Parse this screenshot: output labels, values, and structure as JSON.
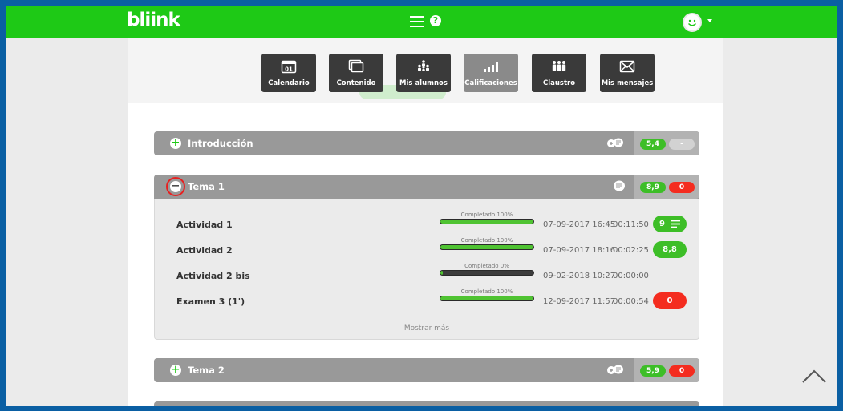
{
  "header": {
    "logo": "bliink",
    "menu_icon": "hamburger-menu-icon",
    "help_icon": "help-icon",
    "help_glyph": "?",
    "avatar_icon": "smiley-avatar-icon",
    "colors": {
      "green": "#1ec916",
      "frame_blue": "#0a5fa3"
    }
  },
  "nav": [
    {
      "label": "Calendario",
      "icon": "calendar-icon",
      "calendar_day": "01",
      "active": false
    },
    {
      "label": "Contenido",
      "icon": "content-icon",
      "active": false
    },
    {
      "label": "Mis alumnos",
      "icon": "students-icon",
      "active": false
    },
    {
      "label": "Calificaciones",
      "icon": "grades-chart-icon",
      "active": true
    },
    {
      "label": "Claustro",
      "icon": "faculty-icon",
      "active": false
    },
    {
      "label": "Mis mensajes",
      "icon": "mail-icon",
      "active": false
    }
  ],
  "sections": [
    {
      "title": "Introducción",
      "expanded": false,
      "score": "5,4",
      "extra": "-"
    },
    {
      "title": "Tema 1",
      "expanded": true,
      "score": "8,9",
      "extra": "0"
    },
    {
      "title": "Tema 2",
      "expanded": false,
      "score": "5,9",
      "extra": "0"
    }
  ],
  "activities": [
    {
      "name": "Actividad 1",
      "progress_label": "Completado 100%",
      "progress": 100,
      "date": "07-09-2017 16:45",
      "duration": "00:11:50",
      "result": "9",
      "result_color": "green",
      "has_comment_icon": true
    },
    {
      "name": "Actividad 2",
      "progress_label": "Completado 100%",
      "progress": 100,
      "date": "07-09-2017 18:16",
      "duration": "00:02:25",
      "result": "8,8",
      "result_color": "green",
      "has_comment_icon": false
    },
    {
      "name": "Actividad 2 bis",
      "progress_label": "Completado 0%",
      "progress": 0,
      "date": "09-02-2018 10:27",
      "duration": "00:00:00",
      "result": "",
      "result_color": "none",
      "has_comment_icon": false
    },
    {
      "name": "Examen 3 (1')",
      "progress_label": "Completado 100%",
      "progress": 100,
      "date": "12-09-2017 11:57",
      "duration": "00:00:54",
      "result": "0",
      "result_color": "red",
      "has_comment_icon": false
    }
  ],
  "show_more": "Mostrar más",
  "scroll_top_icon": "chevron-up-icon"
}
